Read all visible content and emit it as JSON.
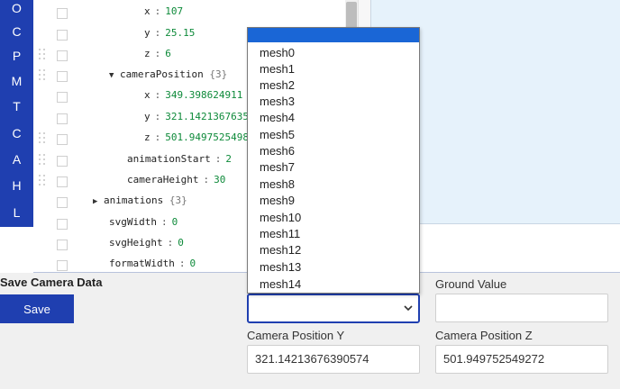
{
  "rail": {
    "letters": [
      "O",
      "C",
      "P",
      "M",
      "T",
      "C",
      "A",
      "H",
      "L"
    ]
  },
  "tree": {
    "rows": [
      {
        "key": "x",
        "sep": ":",
        "val": "107"
      },
      {
        "key": "y",
        "sep": ":",
        "val": "25.15"
      },
      {
        "key": "z",
        "sep": ":",
        "val": "6"
      },
      {
        "key": "cameraPosition",
        "count": "{3}"
      },
      {
        "key": "x",
        "sep": ":",
        "val": "349.398624911"
      },
      {
        "key": "y",
        "sep": ":",
        "val": "321.1421367635"
      },
      {
        "key": "z",
        "sep": ":",
        "val": "501.9497525498"
      },
      {
        "key": "animationStart",
        "sep": ":",
        "val": "2"
      },
      {
        "key": "cameraHeight",
        "sep": ":",
        "val": "30"
      },
      {
        "key": "animations",
        "count": "{3}"
      },
      {
        "key": "svgWidth",
        "sep": ":",
        "val": "0"
      },
      {
        "key": "svgHeight",
        "sep": ":",
        "val": "0"
      },
      {
        "key": "formatWidth",
        "sep": ":",
        "val": "0"
      }
    ]
  },
  "dropdown": {
    "options": [
      "mesh0",
      "mesh1",
      "mesh2",
      "mesh3",
      "mesh4",
      "mesh5",
      "mesh6",
      "mesh7",
      "mesh8",
      "mesh9",
      "mesh10",
      "mesh11",
      "mesh12",
      "mesh13",
      "mesh14"
    ]
  },
  "form": {
    "save_title": "Save Camera Data",
    "save_label": "Save",
    "ground_label": "Ground Value",
    "ground_value": "",
    "select_value": "",
    "cam_y_label": "Camera Position Y",
    "cam_y_value": "321.14213676390574",
    "cam_z_label": "Camera Position Z",
    "cam_z_value": "501.949752549272"
  },
  "colors": {
    "accent": "#1f3fb0",
    "selection": "#1a66d6",
    "value_green": "#0e8a3a",
    "preview_bg": "#e6f2fb"
  }
}
